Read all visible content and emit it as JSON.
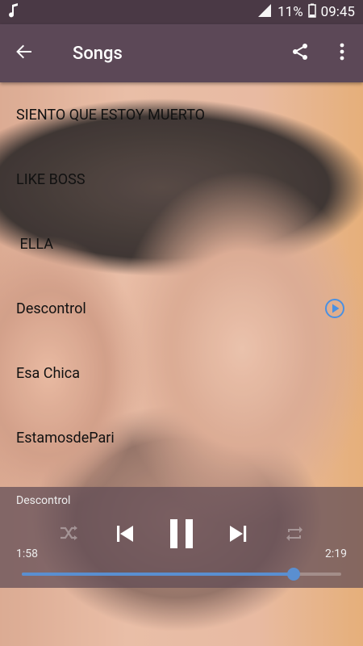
{
  "status": {
    "battery": "11%",
    "time": "09:45"
  },
  "app_bar": {
    "title": "Songs"
  },
  "songs": [
    {
      "title": "SIENTO QUE ESTOY MUERTO"
    },
    {
      "title": "LIKE BOSS"
    },
    {
      "title": " ELLA"
    },
    {
      "title": "Descontrol",
      "playing": true
    },
    {
      "title": "Esa Chica"
    },
    {
      "title": "EstamosdePari"
    }
  ],
  "player": {
    "now_playing": "Descontrol",
    "current_time": "1:58",
    "total_time": "2:19",
    "progress": 0.85
  },
  "colors": {
    "status_bar": "#4a3945",
    "app_bar": "#5c4857",
    "accent": "#5a8fd0",
    "player_bg": "#5f4b55"
  },
  "icons": [
    "music-note-icon",
    "signal-icon",
    "battery-icon",
    "back-arrow-icon",
    "share-icon",
    "more-vert-icon",
    "play-circle-icon",
    "shuffle-icon",
    "skip-previous-icon",
    "pause-icon",
    "skip-next-icon",
    "repeat-icon"
  ]
}
